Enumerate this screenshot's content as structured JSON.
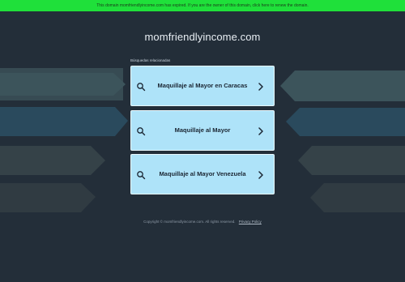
{
  "banner": {
    "text": "This domain momfriendlyincome.com has expired. If you are the owner of this domain, click here to renew the domain."
  },
  "site": {
    "domain": "momfriendlyincome.com"
  },
  "related": {
    "label": "Búsquedas relacionadas",
    "items": [
      {
        "label": "Maquillaje al Mayor en Caracas"
      },
      {
        "label": "Maquillaje al Mayor"
      },
      {
        "label": "Maquillaje al Mayor Venezuela"
      }
    ]
  },
  "footer": {
    "copyright": "Copyright © momfriendlyincome.com.  All rights reserved.",
    "privacy_label": "Privacy Policy"
  },
  "icons": {
    "search": "search-icon",
    "chevron": "chevron-right-icon"
  },
  "colors": {
    "background": "#232e39",
    "banner": "#1fe03a",
    "card": "#aee3f9",
    "text_dark": "#1b2633"
  }
}
